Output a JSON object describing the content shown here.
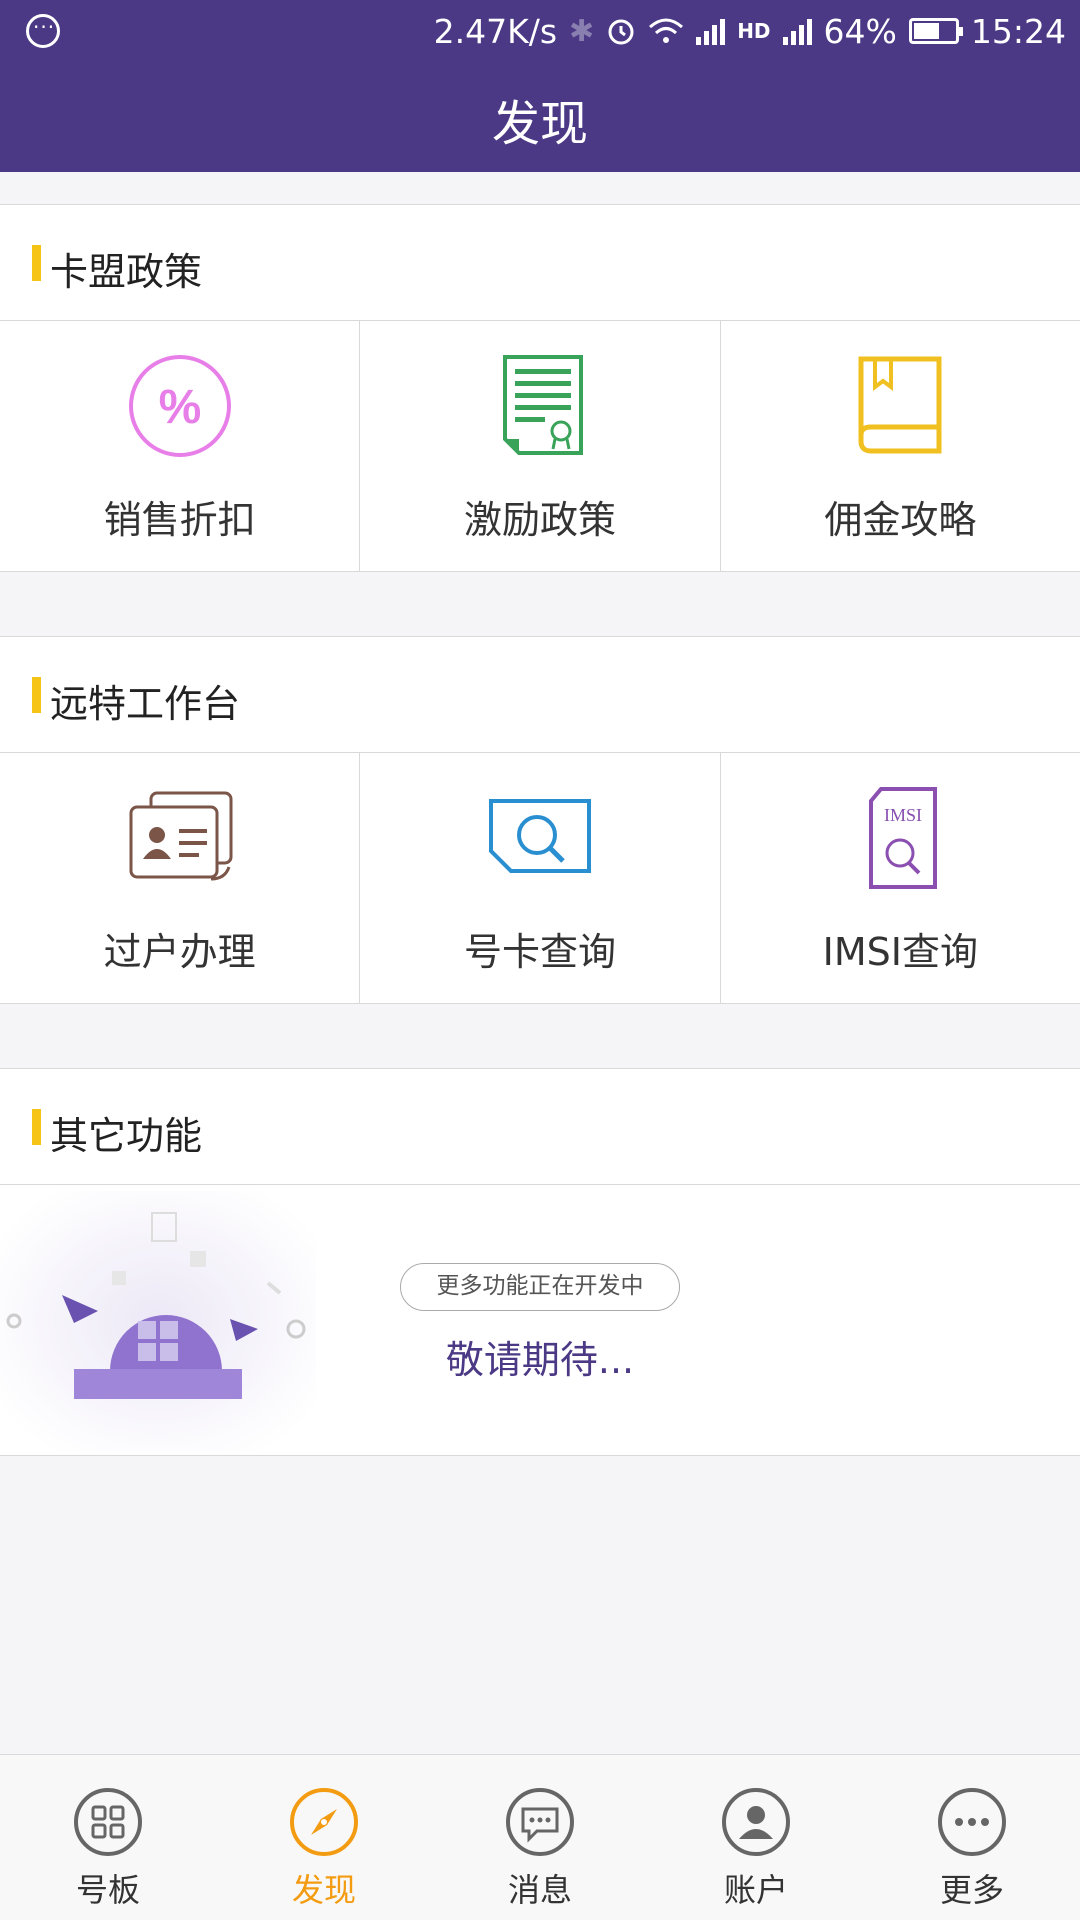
{
  "status_bar": {
    "speed": "2.47K/s",
    "battery_percent": "64%",
    "battery_level": 0.64,
    "time": "15:24"
  },
  "header": {
    "title": "发现"
  },
  "sections": [
    {
      "title": "卡盟政策",
      "items": [
        {
          "label": "销售折扣",
          "icon": "percent-circle-icon",
          "color": "#e87ee8"
        },
        {
          "label": "激励政策",
          "icon": "certificate-icon",
          "color": "#3aa35a"
        },
        {
          "label": "佣金攻略",
          "icon": "book-icon",
          "color": "#f0c020"
        }
      ]
    },
    {
      "title": "远特工作台",
      "items": [
        {
          "label": "过户办理",
          "icon": "id-card-transfer-icon",
          "color": "#7a5548"
        },
        {
          "label": "号卡查询",
          "icon": "card-search-icon",
          "color": "#2a8fd0"
        },
        {
          "label": "IMSI查询",
          "icon": "imsi-sim-search-icon",
          "color": "#8a4fb0"
        }
      ]
    },
    {
      "title": "其它功能",
      "coming_soon_tag": "更多功能正在开发中",
      "coming_soon_text": "敬请期待..."
    }
  ],
  "tab_bar": [
    {
      "label": "号板",
      "icon": "grid-icon",
      "active": false
    },
    {
      "label": "发现",
      "icon": "compass-icon",
      "active": true
    },
    {
      "label": "消息",
      "icon": "message-icon",
      "active": false
    },
    {
      "label": "账户",
      "icon": "user-icon",
      "active": false
    },
    {
      "label": "更多",
      "icon": "more-icon",
      "active": false
    }
  ],
  "colors": {
    "primary": "#4b3986",
    "accent": "#f6c417",
    "tab_active": "#f39c12"
  }
}
